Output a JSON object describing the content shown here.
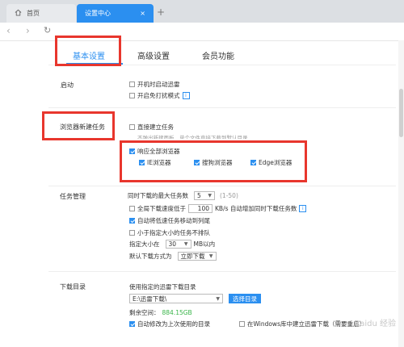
{
  "browser": {
    "tabs": [
      {
        "label": "首页",
        "icon": "home-icon"
      },
      {
        "label": "设置中心",
        "close": "×"
      }
    ],
    "new_tab": "+",
    "nav": {
      "back": "‹",
      "forward": "›",
      "refresh": "↻"
    }
  },
  "settings_tabs": [
    "基本设置",
    "高级设置",
    "会员功能"
  ],
  "startup": {
    "label": "启动",
    "options": [
      {
        "label": "开机时启动迅雷",
        "checked": false
      },
      {
        "label": "开启免打扰模式",
        "checked": false
      }
    ]
  },
  "browser_task": {
    "label": "浏览器新建任务",
    "direct": {
      "label": "直接建立任务",
      "checked": false
    },
    "hint": "不弹出新建面板，单个文件直接下载到默认目录",
    "respond_all": {
      "label": "响应全部浏览器",
      "checked": true
    },
    "browsers": [
      {
        "label": "IE浏览器",
        "checked": true
      },
      {
        "label": "搜狗浏览器",
        "checked": true
      },
      {
        "label": "Edge浏览器",
        "checked": true
      }
    ]
  },
  "task_mgmt": {
    "label": "任务管理",
    "max_tasks_label": "同时下载的最大任务数",
    "max_tasks_value": "5",
    "max_tasks_range": "(1-50)",
    "speed_label_pre": "全局下载速度低于",
    "speed_value": "100",
    "speed_label_post": "KB/s 自动增加同时下载任务数",
    "speed_checked": false,
    "move_slow": {
      "label": "自动将低速任务移动到列尾",
      "checked": true
    },
    "small_tasks": {
      "label": "小于指定大小的任务不排队",
      "checked": false
    },
    "size_label_pre": "指定大小在",
    "size_value": "30",
    "size_label_post": "MB以内",
    "default_mode_label": "默认下载方式为",
    "default_mode_value": "立即下载"
  },
  "download_dir": {
    "label": "下载目录",
    "use_specified": "使用指定的迅雷下载目录",
    "path": "E:\\迅雷下载\\",
    "choose_btn": "选择目录",
    "free_label": "剩余空间：",
    "free_value": "884.15GB",
    "auto_modify": {
      "label": "自动修改为上次使用的目录",
      "checked": true
    },
    "windows_lib": {
      "label": "在Windows库中建立迅雷下载（需要重启）",
      "checked": false
    }
  },
  "watermark": "Baidu 经验"
}
